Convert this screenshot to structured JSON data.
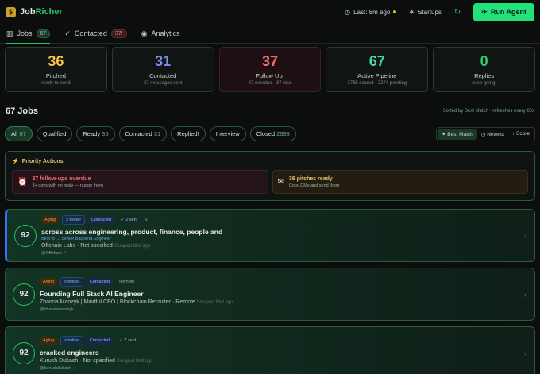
{
  "app": {
    "name_prefix": "Job",
    "name_accent": "Richer"
  },
  "topbar": {
    "last_updated": "Last: 8m ago",
    "startups_label": "Startups",
    "run_label": "Run Agent"
  },
  "tabs": [
    {
      "label": "Jobs",
      "badge": "67"
    },
    {
      "label": "Contacted",
      "badge": "37!"
    },
    {
      "label": "Analytics"
    }
  ],
  "stats": [
    {
      "num": "36",
      "label": "Pitched",
      "sub": "ready to send",
      "color": "#f5c542"
    },
    {
      "num": "31",
      "label": "Contacted",
      "sub": "37 messages sent",
      "color": "#7b8cf0"
    },
    {
      "num": "37",
      "label": "Follow Up!",
      "sub": "37 overdue · 37 total",
      "color": "#f07070"
    },
    {
      "num": "67",
      "label": "Active Pipeline",
      "sub": "2765 scored · 2274 pending",
      "color": "#4ad6a0"
    },
    {
      "num": "0",
      "label": "Replies",
      "sub": "keep going!",
      "color": "#2fcf6a"
    }
  ],
  "jobs": {
    "title": "67 Jobs",
    "meta": "Sorted by Best Match · refreshes every 60s"
  },
  "filters": [
    {
      "label": "All",
      "count": "67"
    },
    {
      "label": "Qualified",
      "count": ""
    },
    {
      "label": "Ready",
      "count": "36"
    },
    {
      "label": "Contacted",
      "count": "31"
    },
    {
      "label": "Replied!",
      "count": ""
    },
    {
      "label": "Interview",
      "count": ""
    },
    {
      "label": "Closed",
      "count": "2698"
    }
  ],
  "sorts": [
    "Best Match",
    "Newest",
    "Score"
  ],
  "priority": {
    "title": "Priority Actions",
    "items": [
      {
        "title": "37 follow-ups overdue",
        "sub": "3+ days with no reply — nudge them"
      },
      {
        "title": "36 pitches ready",
        "sub": "Copy DMs and send them"
      }
    ]
  },
  "cards": [
    {
      "score": "92",
      "aging": "Aging",
      "source": "x twitter",
      "status": "Contacted",
      "sent": "✓ 2 sent",
      "title": "across across engineering, product, finance, people and",
      "fit": "Best fit → Senior Backend Engineer",
      "company": "Offchain Labs · Not specified",
      "scraped": "Scraped 8hd ago",
      "handle": "@Offchain ✓"
    },
    {
      "score": "92",
      "aging": "Aging",
      "source": "x twitter",
      "status": "Contacted",
      "extra": "Remote",
      "title": "Founding Full Stack AI Engineer",
      "company": "Zhanna Manzyk | Mindful CEO | Blockchain Recruiter · Remote",
      "scraped": "Scraped 8hd ago",
      "handle": "@zhannamanzyk"
    },
    {
      "score": "92",
      "aging": "Aging",
      "source": "x twitter",
      "status": "Contacted",
      "sent": "✓ 2 sent",
      "title": "cracked engineers",
      "company": "Kurush Dubash · Not specified",
      "scraped": "Scraped 8hd ago",
      "handle": "@kurushdubash ✓"
    }
  ]
}
